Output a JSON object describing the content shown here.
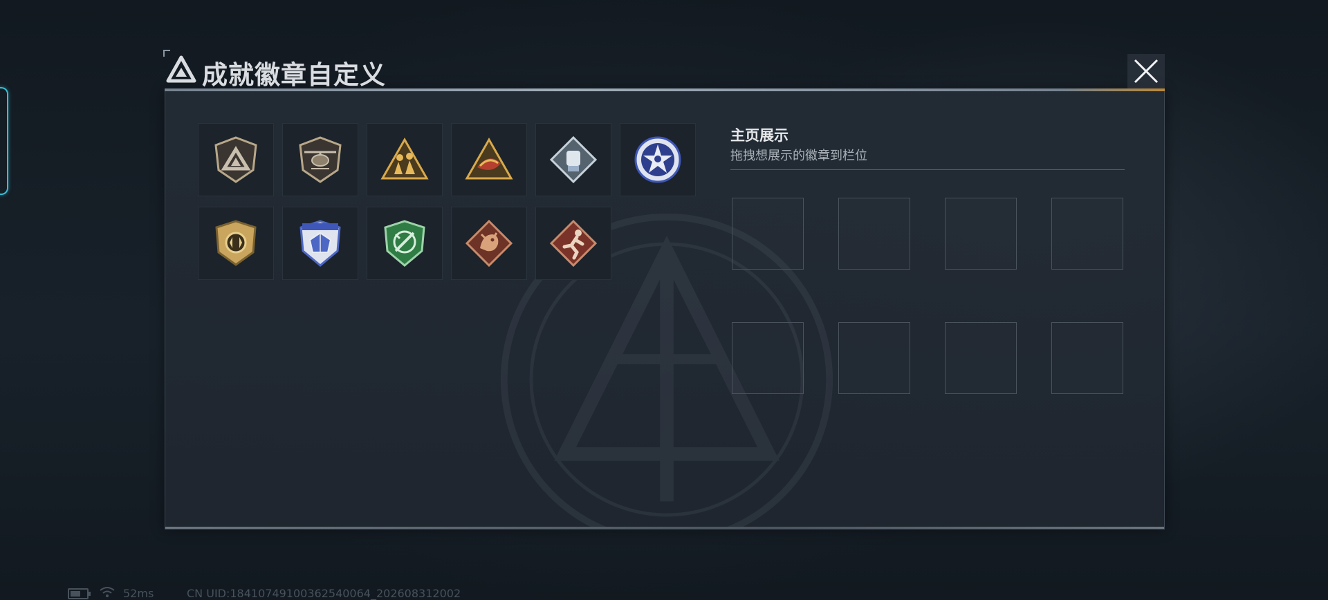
{
  "dialog": {
    "title": "成就徽章自定义"
  },
  "badges": [
    {
      "name": "triangle-shield-badge",
      "color": "#b8a88a"
    },
    {
      "name": "helicopter-shield-badge",
      "color": "#b8a88a"
    },
    {
      "name": "soldiers-triangle-badge",
      "color": "#d9a94a"
    },
    {
      "name": "fish-triangle-badge",
      "color": "#d9a94a"
    },
    {
      "name": "fist-diamond-badge",
      "color": "#9bb0c8"
    },
    {
      "name": "star-skull-round-badge",
      "color": "#3f57b8"
    },
    {
      "name": "eagle-shield-gold-badge",
      "color": "#c9a55e"
    },
    {
      "name": "crystal-blue-shield-badge",
      "color": "#4d67c4"
    },
    {
      "name": "sword-green-shield-badge",
      "color": "#2f7c45"
    },
    {
      "name": "dragon-diamond-badge",
      "color": "#9a4a36"
    },
    {
      "name": "runner-diamond-badge",
      "color": "#a04a3c"
    }
  ],
  "showcase": {
    "title": "主页展示",
    "hint": "拖拽想展示的徽章到栏位",
    "slot_count": 8
  },
  "status": {
    "ping": "52ms",
    "uid": "CN UID:18410749100362540064_202608312002"
  },
  "colors": {
    "accent_cyan": "#37bfd6",
    "title_rule": "#b9c7d4",
    "gold_accent": "#d79b3a"
  }
}
